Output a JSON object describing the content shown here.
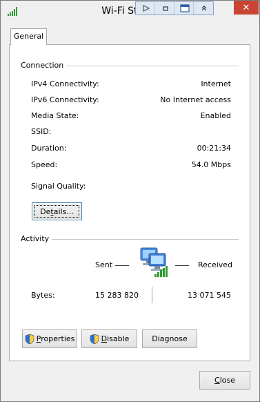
{
  "window": {
    "title": "Wi-Fi Status",
    "close_glyph": "✕"
  },
  "tabs": [
    {
      "label": "General"
    }
  ],
  "connection": {
    "group_label": "Connection",
    "rows": [
      {
        "label": "IPv4 Connectivity:",
        "value": "Internet"
      },
      {
        "label": "IPv6 Connectivity:",
        "value": "No Internet access"
      },
      {
        "label": "Media State:",
        "value": "Enabled"
      },
      {
        "label": "SSID:",
        "value": ""
      },
      {
        "label": "Duration:",
        "value": "00:21:34"
      },
      {
        "label": "Speed:",
        "value": "54.0 Mbps"
      }
    ],
    "signal_quality_label": "Signal Quality:",
    "details_button": {
      "first": "De",
      "mnemonic": "t",
      "rest": "ails..."
    }
  },
  "activity": {
    "group_label": "Activity",
    "sent_label": "Sent",
    "received_label": "Received",
    "bytes_label": "Bytes:",
    "bytes_sent": "15 283 820",
    "bytes_received": "13 071 545"
  },
  "buttons": {
    "properties": {
      "mnemonic": "P",
      "rest": "roperties"
    },
    "disable": {
      "mnemonic": "D",
      "rest": "isable"
    },
    "diagnose": {
      "label": "Diagnose"
    },
    "close": {
      "mnemonic": "C",
      "rest": "lose"
    }
  },
  "icons": {
    "title": "wifi-signal-icon",
    "activity": "network-computers-icon",
    "shield": "uac-shield-icon"
  },
  "colors": {
    "close_button": "#c94433",
    "signal_green": "#2f9e2f"
  }
}
